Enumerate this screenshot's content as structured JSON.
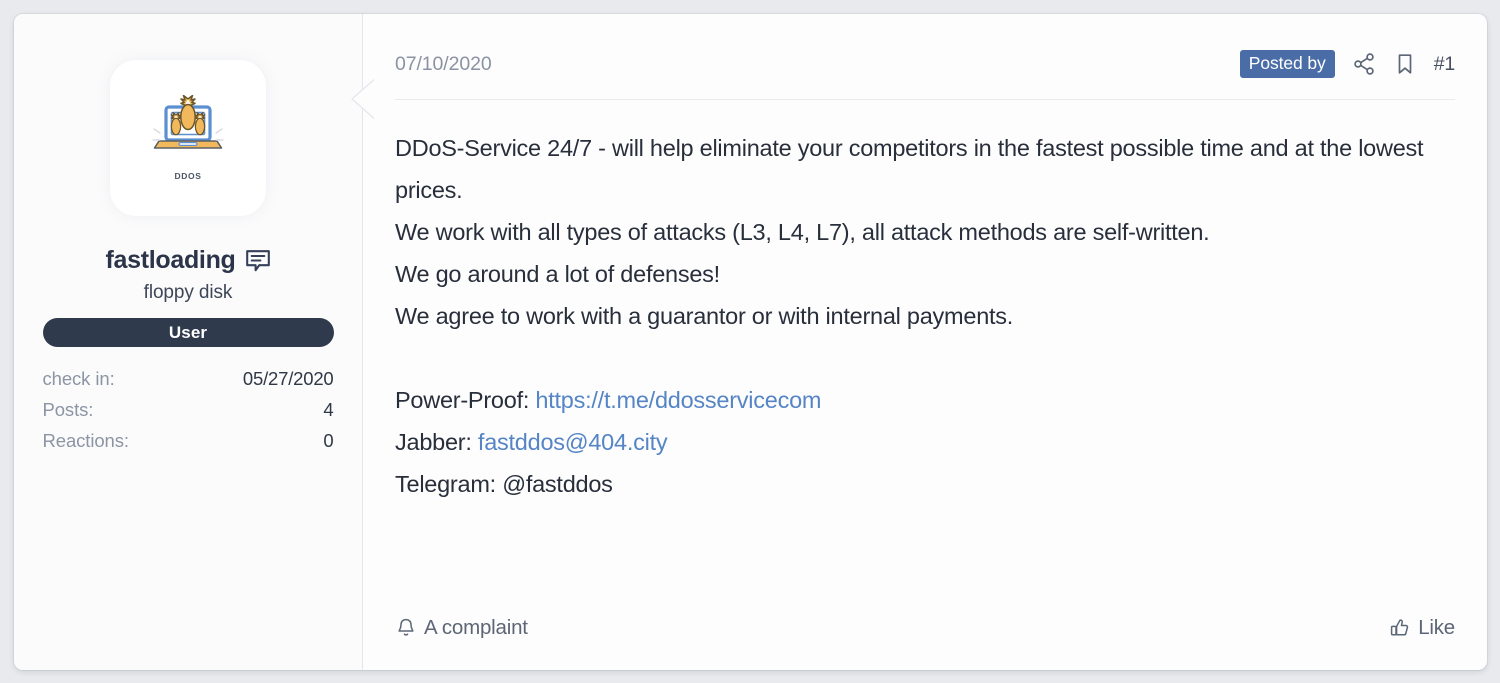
{
  "user_panel": {
    "avatar": {
      "icon": "ddos-laptop-bomb-icon",
      "caption": "DDOS"
    },
    "username": "fastloading",
    "message_icon": "comment-bubble-icon",
    "user_title": "floppy disk",
    "role_badge": "User",
    "stats": [
      {
        "label": "check in:",
        "value": "05/27/2020"
      },
      {
        "label": "Posts:",
        "value": "4"
      },
      {
        "label": "Reactions:",
        "value": "0"
      }
    ]
  },
  "post": {
    "date": "07/10/2020",
    "posted_by_badge": "Posted by",
    "share_icon": "share-nodes-icon",
    "bookmark_icon": "bookmark-icon",
    "post_number": "#1",
    "body": {
      "line1": "DDoS-Service 24/7 - will help eliminate your competitors in the fastest possible time and at the lowest prices.",
      "line2": "We work with all types of attacks (L3, L4, L7), all attack methods are self-written.",
      "line3": "We go around a lot of defenses!",
      "line4": "We agree to work with a guarantor or with internal payments.",
      "contact_power_proof_label": "Power-Proof: ",
      "contact_power_proof_link": "https://t.me/ddosservicecom",
      "contact_jabber_label": "Jabber: ",
      "contact_jabber_link": "fastddos@404.city",
      "contact_telegram": "Telegram: @fastddos"
    },
    "footer": {
      "complaint_icon": "bell-icon",
      "complaint_label": "A complaint",
      "like_icon": "thumbs-up-icon",
      "like_label": "Like"
    }
  },
  "colors": {
    "page_background": "#e9eaee",
    "card_background": "#fdfdfe",
    "role_badge": "#303a4d",
    "posted_by_badge": "#4a6da7",
    "link": "#5585c5",
    "muted_text": "#8a93a2",
    "body_text": "#282f3b"
  }
}
